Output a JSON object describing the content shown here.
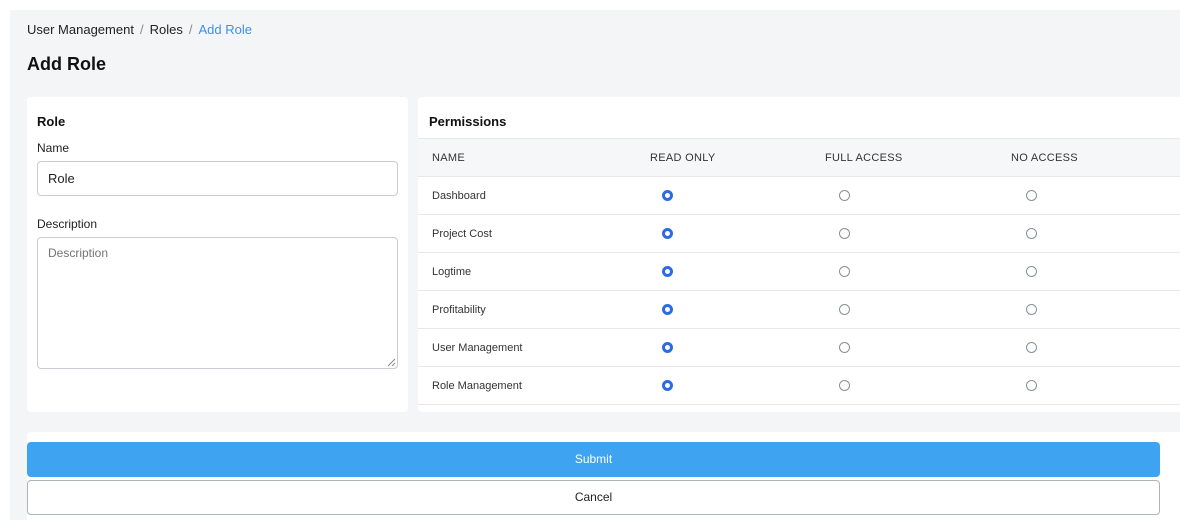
{
  "breadcrumb": {
    "items": [
      "User Management",
      "Roles"
    ],
    "current": "Add Role",
    "separator": "/"
  },
  "page_title": "Add Role",
  "role_card": {
    "title": "Role",
    "name_label": "Name",
    "name_value": "Role",
    "description_label": "Description",
    "description_placeholder": "Description"
  },
  "permissions": {
    "title": "Permissions",
    "columns": [
      "NAME",
      "READ ONLY",
      "FULL ACCESS",
      "NO ACCESS"
    ],
    "rows": [
      {
        "name": "Dashboard",
        "selected": "READ ONLY"
      },
      {
        "name": "Project Cost",
        "selected": "READ ONLY"
      },
      {
        "name": "Logtime",
        "selected": "READ ONLY"
      },
      {
        "name": "Profitability",
        "selected": "READ ONLY"
      },
      {
        "name": "User Management",
        "selected": "READ ONLY"
      },
      {
        "name": "Role Management",
        "selected": "READ ONLY"
      }
    ]
  },
  "actions": {
    "submit_label": "Submit",
    "cancel_label": "Cancel"
  },
  "colors": {
    "accent": "#3ea4f2",
    "breadcrumb_current": "#3d8ff0",
    "radio_checked": "#2d6be4",
    "page_background": "#f4f5f7"
  },
  "icons": {
    "radio_checked": "radio-checked-icon",
    "radio_unchecked": "radio-unchecked-icon",
    "resize": "resize-handle-icon"
  }
}
